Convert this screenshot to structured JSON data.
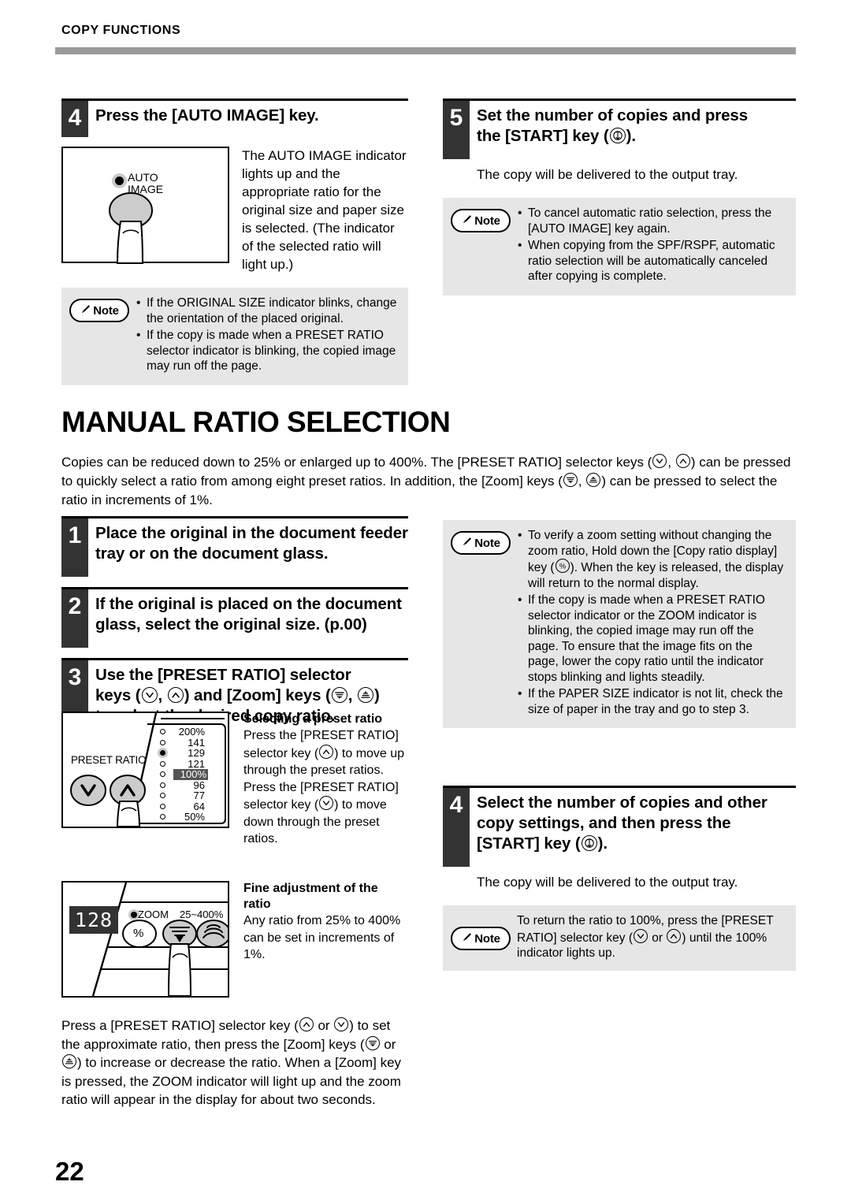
{
  "header": {
    "running_head": "COPY FUNCTIONS"
  },
  "page_number": "22",
  "auto_image_step": {
    "number": "4",
    "title": "Press the [AUTO IMAGE] key.",
    "body": "The AUTO IMAGE indicator lights up and the appropriate ratio for the original size and paper size is selected. (The indicator of the selected ratio will light up.)",
    "illustration": {
      "label_line1": "AUTO",
      "label_line2": "IMAGE"
    },
    "note": {
      "label": "Note",
      "items": [
        "If the ORIGINAL SIZE indicator blinks, change the orientation of the placed original.",
        "If the copy is made when a PRESET RATIO selector indicator is blinking, the copied image may run off the page."
      ]
    }
  },
  "start_step": {
    "number": "5",
    "title_part1": "Set the number of copies and press",
    "title_part2_pre": "the [START] key (",
    "title_part2_post": ").",
    "body": "The copy will be delivered to the output tray.",
    "note": {
      "label": "Note",
      "items": [
        "To cancel automatic ratio selection, press the [AUTO IMAGE] key again.",
        "When copying from the SPF/RSPF, automatic ratio selection will be automatically canceled after copying is complete."
      ]
    }
  },
  "section": {
    "title": "MANUAL RATIO SELECTION",
    "intro_a": "Copies can be reduced down to 25% or enlarged up to 400%. The [PRESET RATIO] selector keys (",
    "intro_b": ", ",
    "intro_c": ") can be pressed to quickly select a ratio from among eight preset ratios. In addition, the [Zoom] keys (",
    "intro_d": ", ",
    "intro_e": ") can be pressed to select the ratio in increments of 1%."
  },
  "manual_steps": [
    {
      "number": "1",
      "title": "Place the original in the document feeder tray or on the document glass."
    },
    {
      "number": "2",
      "title": "If the original is placed on the document glass, select the original size. (p.00)"
    }
  ],
  "step3": {
    "number": "3",
    "title_a": "Use the [PRESET RATIO] selector",
    "title_b_pre": "keys (",
    "title_b_mid": ", ",
    "title_b_mid2": ") and [Zoom] keys (",
    "title_b_mid3": ", ",
    "title_b_post": ")",
    "title_c": "to select the desired copy ratio."
  },
  "preset_panel": {
    "label": "PRESET RATIO",
    "ratios": [
      {
        "value": "200%",
        "state": "off"
      },
      {
        "value": "141",
        "state": "off"
      },
      {
        "value": "129",
        "state": "lit"
      },
      {
        "value": "121",
        "state": "off"
      },
      {
        "value": "100%",
        "state": "highlight"
      },
      {
        "value": "96",
        "state": "off"
      },
      {
        "value": "77",
        "state": "off"
      },
      {
        "value": "64",
        "state": "off"
      },
      {
        "value": "50%",
        "state": "off"
      }
    ]
  },
  "preset_text": {
    "heading": "Selecting a preset ratio",
    "line_a_pre": "Press the [PRESET RATIO] selector key (",
    "line_a_post": ") to move up through the preset ratios.",
    "line_b_pre": "Press the [PRESET RATIO] selector key (",
    "line_b_post": ") to move down through the preset ratios."
  },
  "zoom_panel": {
    "display_value": "128",
    "zoom_label": "ZOOM",
    "range_label": "25~400%",
    "percent_key_label": "%"
  },
  "zoom_text": {
    "heading_line1": "Fine adjustment of the",
    "heading_line2": "ratio",
    "body": "Any ratio from 25% to 400% can be set in increments of 1%."
  },
  "closing_paragraph": {
    "a_pre": "Press a [PRESET RATIO] selector key (",
    "a_or": " or ",
    "a_post": ") to set the approximate ratio, then press the [Zoom] keys (",
    "b_or": " or ",
    "b_post": ") to increase or decrease the ratio.",
    "c": "When a [Zoom] key  is pressed, the ZOOM indicator will light up and the zoom ratio will appear in the display for about two seconds."
  },
  "zoom_note": {
    "label": "Note",
    "items": [
      "To verify a zoom setting without changing the zoom ratio, Hold down the [Copy ratio display] key (%). When the key is released, the display will return to the normal display.",
      "If the copy is made when a PRESET RATIO selector indicator or the ZOOM indicator is blinking, the copied image may run off the page. To ensure that the image fits on the page, lower the copy ratio until the indicator stops blinking and lights steadily.",
      "If the PAPER SIZE indicator is not lit, check the size of paper in the tray and go to step 3."
    ],
    "item1_pre": "To verify a zoom setting without changing the zoom ratio, Hold down the [Copy ratio display] key (",
    "item1_post": "). When the key is released, the display will return to the normal display."
  },
  "final_step": {
    "number": "4",
    "title_a": "Select the number of copies and other",
    "title_b": "copy settings, and then press the",
    "title_c_pre": "[START] key (",
    "title_c_post": ").",
    "body": "The copy will be delivered to the output tray.",
    "note": {
      "label": "Note",
      "text_a": "To return the ratio to 100%, press the [PRESET RATIO] selector key (",
      "text_or": " or ",
      "text_b": ") until the 100% indicator lights up."
    }
  },
  "colors": {
    "rule_gray": "#9b9b9b",
    "step_badge": "#333333",
    "note_bg": "#e6e6e6",
    "lcd_bg": "#333333"
  }
}
